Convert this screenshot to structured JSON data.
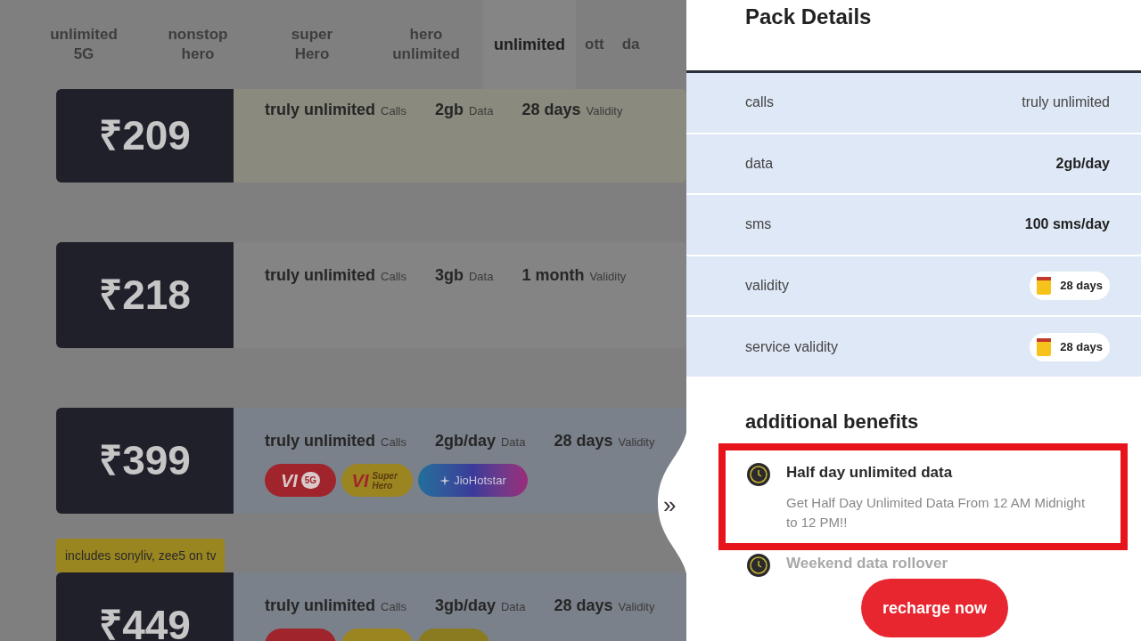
{
  "tabs": [
    {
      "label": "unlimited\n5G",
      "selected": false
    },
    {
      "label": "nonstop\nhero",
      "selected": false
    },
    {
      "label": "super\nHero",
      "selected": false
    },
    {
      "label": "hero\nunlimited",
      "selected": false
    },
    {
      "label": "unlimited",
      "selected": true
    },
    {
      "label": "ott",
      "selected": false
    },
    {
      "label": "da",
      "selected": false
    }
  ],
  "plans": [
    {
      "price": "₹209",
      "color": "#8a8a7e",
      "features": [
        {
          "value": "truly unlimited",
          "label": "Calls"
        },
        {
          "value": "2gb",
          "label": "Data"
        },
        {
          "value": "28 days",
          "label": "Validity"
        }
      ]
    },
    {
      "price": "₹218",
      "color": "#848484",
      "features": [
        {
          "value": "truly unlimited",
          "label": "Calls"
        },
        {
          "value": "3gb",
          "label": "Data"
        },
        {
          "value": "1 month",
          "label": "Validity"
        }
      ]
    },
    {
      "price": "₹399",
      "color": "#7b818a",
      "features": [
        {
          "value": "truly unlimited",
          "label": "Calls"
        },
        {
          "value": "2gb/day",
          "label": "Data"
        },
        {
          "value": "28 days",
          "label": "Validity"
        }
      ],
      "badges": [
        {
          "kind": "vi_5g",
          "brand": "VI",
          "label": "5G"
        },
        {
          "kind": "vi_hero",
          "brand": "VI",
          "label": "Super Hero"
        },
        {
          "kind": "jiohotstar",
          "label": "JioHotstar"
        }
      ]
    },
    {
      "price": "₹449",
      "color": "#7b818a",
      "tag": "includes sonyliv, zee5 on tv",
      "features": [
        {
          "value": "truly unlimited",
          "label": "Calls"
        },
        {
          "value": "3gb/day",
          "label": "Data"
        },
        {
          "value": "28 days",
          "label": "Validity"
        }
      ],
      "badges": [
        {
          "kind": "vi_5g"
        },
        {
          "kind": "vi_hero"
        },
        {
          "kind": "plain"
        }
      ]
    }
  ],
  "panel": {
    "title": "Pack Details",
    "details": [
      {
        "label": "calls",
        "value": "truly unlimited",
        "kind": "text"
      },
      {
        "label": "data",
        "value": "2gb/day",
        "kind": "bold"
      },
      {
        "label": "sms",
        "value": "100 sms/day",
        "kind": "bold"
      },
      {
        "label": "validity",
        "value": "28 days",
        "kind": "chip"
      },
      {
        "label": "service validity",
        "value": "28 days",
        "kind": "chip"
      }
    ],
    "benefits_title": "additional benefits",
    "benefits": [
      {
        "title": "Half day unlimited data",
        "description": "Get Half Day Unlimited Data From 12 AM Midnight to 12 PM!!",
        "highlighted": true,
        "faded": false
      },
      {
        "title": "Weekend data rollover",
        "highlighted": false,
        "faded": true
      }
    ],
    "collapse_handle": "»",
    "cta": "recharge now"
  }
}
